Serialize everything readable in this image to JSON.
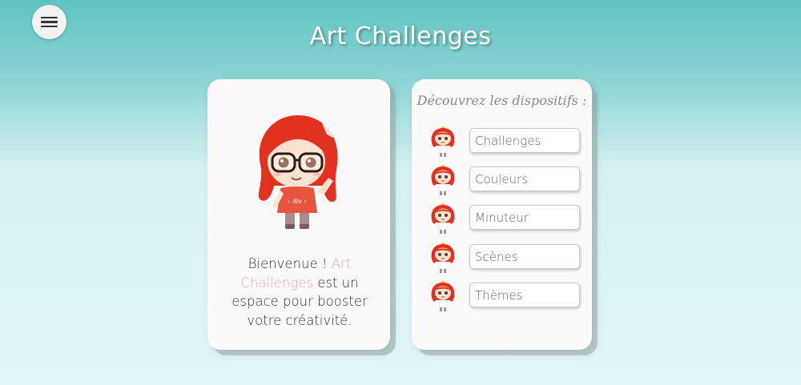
{
  "header": {
    "title": "Art Challenges",
    "menu_icon": "hamburger-menu-icon"
  },
  "welcome_card": {
    "mascot": "mascot-girl-illustration",
    "text_before": "Bienvenue ! ",
    "text_highlight": "Art Challenges",
    "text_after": " est un espace pour booster votre créativité.",
    "highlight_color": "#f2a7a8"
  },
  "devices_card": {
    "heading": "Découvrez les dispositifs :",
    "items": [
      {
        "label": "Challenges",
        "icon": "mascot-mini-icon"
      },
      {
        "label": "Couleurs",
        "icon": "mascot-mini-icon"
      },
      {
        "label": "Minuteur",
        "icon": "mascot-mini-icon"
      },
      {
        "label": "Scènes",
        "icon": "mascot-mini-icon"
      },
      {
        "label": "Thèmes",
        "icon": "mascot-mini-icon"
      }
    ]
  },
  "colors": {
    "card_background": "#fcf9fa",
    "accent_pink": "#f2a7a8",
    "hair_red": "#e2321f"
  }
}
